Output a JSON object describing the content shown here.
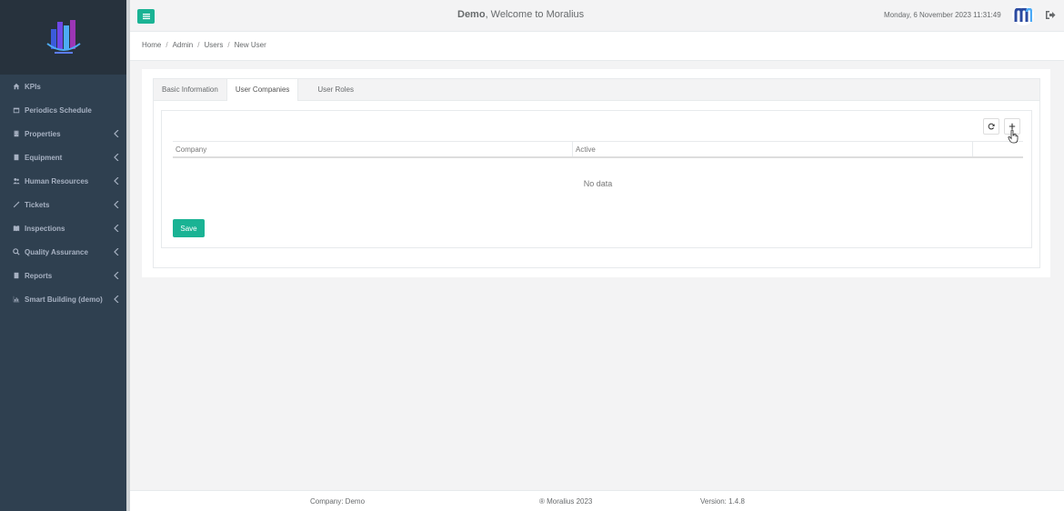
{
  "sidebar": {
    "items": [
      {
        "label": "KPIs",
        "icon": "home-icon",
        "has_children": false
      },
      {
        "label": "Periodics Schedule",
        "icon": "calendar-icon",
        "has_children": false
      },
      {
        "label": "Properties",
        "icon": "building-icon",
        "has_children": true
      },
      {
        "label": "Equipment",
        "icon": "book-icon",
        "has_children": true
      },
      {
        "label": "Human Resources",
        "icon": "users-icon",
        "has_children": true
      },
      {
        "label": "Tickets",
        "icon": "magic-icon",
        "has_children": true
      },
      {
        "label": "Inspections",
        "icon": "book-open-icon",
        "has_children": true
      },
      {
        "label": "Quality Assurance",
        "icon": "search-icon",
        "has_children": true
      },
      {
        "label": "Reports",
        "icon": "book-icon",
        "has_children": true
      },
      {
        "label": "Smart Building (demo)",
        "icon": "chart-icon",
        "has_children": true
      }
    ]
  },
  "header": {
    "company": "Demo",
    "welcome": ", Welcome to Moralius",
    "datetime": "Monday, 6 November 2023 11:31:49"
  },
  "breadcrumb": [
    "Home",
    "Admin",
    "Users",
    "New User"
  ],
  "tabs": [
    {
      "label": "Basic Information",
      "active": false
    },
    {
      "label": "User Companies",
      "active": true
    },
    {
      "label": "User Roles",
      "active": false
    }
  ],
  "grid": {
    "columns": [
      "Company",
      "Active"
    ],
    "empty_text": "No data"
  },
  "actions": {
    "save_label": "Save"
  },
  "footer": {
    "company": "Company: Demo",
    "copyright": "® Moralius 2023",
    "version": "Version: 1.4.8"
  },
  "colors": {
    "accent": "#1ab394",
    "sidebar": "#2f4050"
  }
}
